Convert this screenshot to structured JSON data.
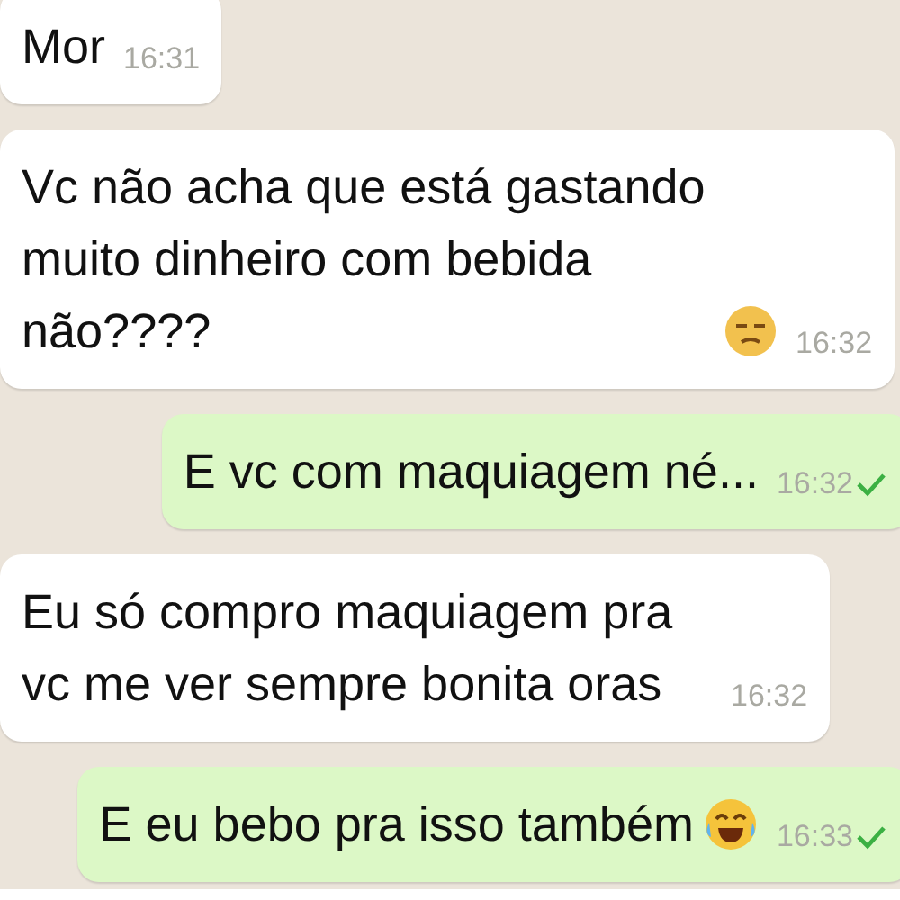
{
  "messages": [
    {
      "outgoing": false,
      "text": "Mor",
      "time": "16:31"
    },
    {
      "outgoing": false,
      "text": "Vc não acha que está gastando muito dinheiro com bebida não????",
      "emoji": {
        "kind": "unamused"
      },
      "time": "16:32"
    },
    {
      "outgoing": true,
      "text": "E vc com maquiagem né...",
      "time": "16:32",
      "delivered": true
    },
    {
      "outgoing": false,
      "text": "Eu só compro maquiagem pra vc me ver sempre bonita oras",
      "time": "16:32"
    },
    {
      "outgoing": true,
      "text": "E eu bebo pra isso também",
      "emoji": {
        "kind": "tears-of-joy"
      },
      "time": "16:33",
      "delivered": true
    }
  ]
}
